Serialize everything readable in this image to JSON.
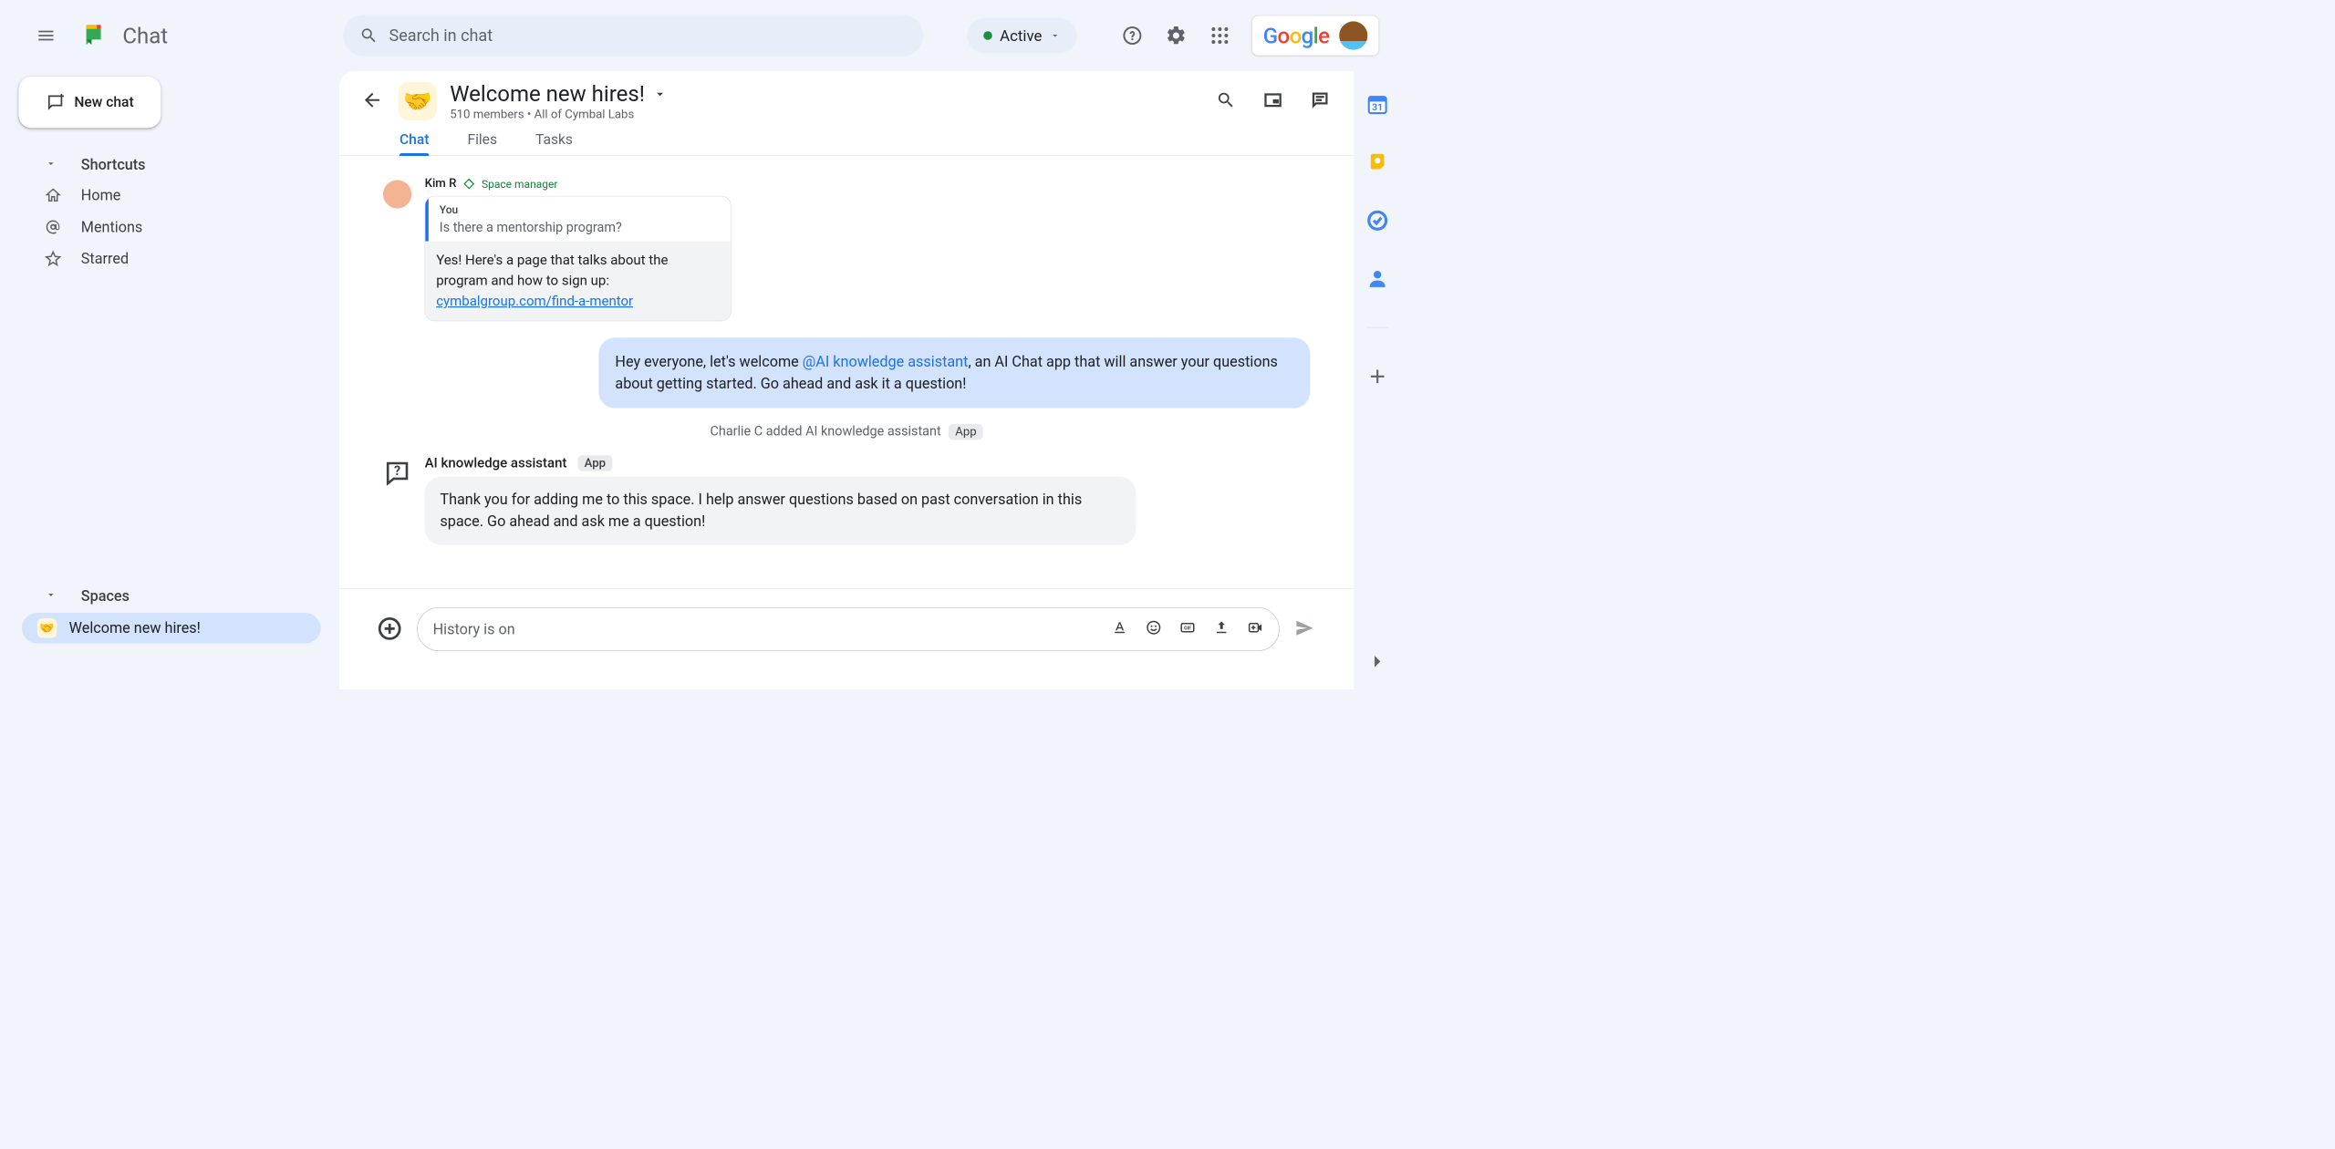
{
  "topbar": {
    "app_name": "Chat",
    "search_placeholder": "Search in chat",
    "status_label": "Active"
  },
  "sidebar": {
    "new_chat_label": "New chat",
    "shortcuts_label": "Shortcuts",
    "shortcuts": {
      "home": "Home",
      "mentions": "Mentions",
      "starred": "Starred"
    },
    "spaces_label": "Spaces",
    "active_space": "Welcome new hires!"
  },
  "space": {
    "title": "Welcome new hires!",
    "subtitle": "510 members  •  All of Cymbal Labs",
    "tabs": {
      "chat": "Chat",
      "files": "Files",
      "tasks": "Tasks"
    }
  },
  "messages": {
    "kim": {
      "name": "Kim R",
      "role": "Space manager",
      "quote_author": "You",
      "quote_text": "Is there a mentorship program?",
      "answer_prefix": "Yes! Here's a page that talks about the program and how to sign up: ",
      "answer_link": "cymbalgroup.com/find-a-mentor"
    },
    "welcome": {
      "before": "Hey everyone, let's welcome ",
      "mention": "@AI knowledge assistant",
      "after": ", an AI Chat app that will answer your questions about getting started.  Go ahead and ask it a question!"
    },
    "system": {
      "text": "Charlie C added AI knowledge assistant",
      "chip": "App"
    },
    "bot": {
      "name": "AI knowledge assistant",
      "chip": "App",
      "text": "Thank you for adding me to this space. I help answer questions based on past conversation in this space. Go ahead and ask me a question!"
    }
  },
  "composer": {
    "placeholder": "History is on"
  }
}
